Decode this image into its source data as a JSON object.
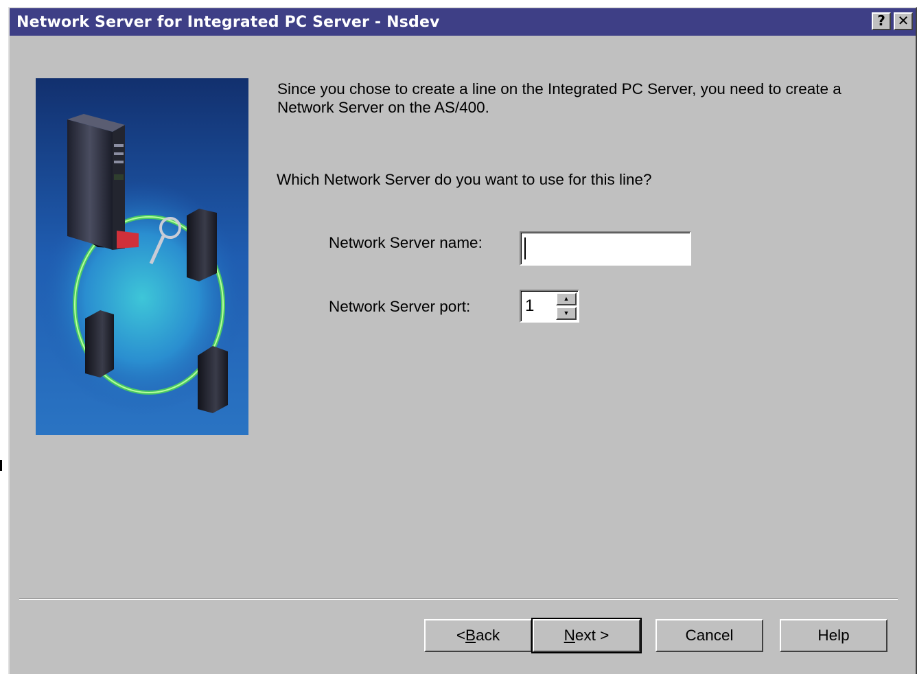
{
  "window": {
    "title": "Network Server for Integrated PC Server - Nsdev",
    "help_button": "?",
    "close_button": "✕"
  },
  "content": {
    "intro_line1": "Since you chose to create a line on the Integrated PC Server, you need to create a",
    "intro_line2": "Network Server on the AS/400.",
    "question": "Which Network Server do you want to use for this line?",
    "name_label": "Network Server name:",
    "name_value": "",
    "port_label": "Network Server port:",
    "port_value": "1"
  },
  "buttons": {
    "back": {
      "pre": "< ",
      "mnemonic": "B",
      "post": "ack"
    },
    "next": {
      "pre": "",
      "mnemonic": "N",
      "post": "ext >"
    },
    "cancel": "Cancel",
    "help": "Help"
  },
  "colors": {
    "titlebar": "#3e3f86",
    "dialog": "#c0c0c0"
  },
  "icons": {
    "help": "help-question-icon",
    "close": "close-icon",
    "spin_up": "spin-up-arrow-icon",
    "spin_down": "spin-down-arrow-icon"
  }
}
